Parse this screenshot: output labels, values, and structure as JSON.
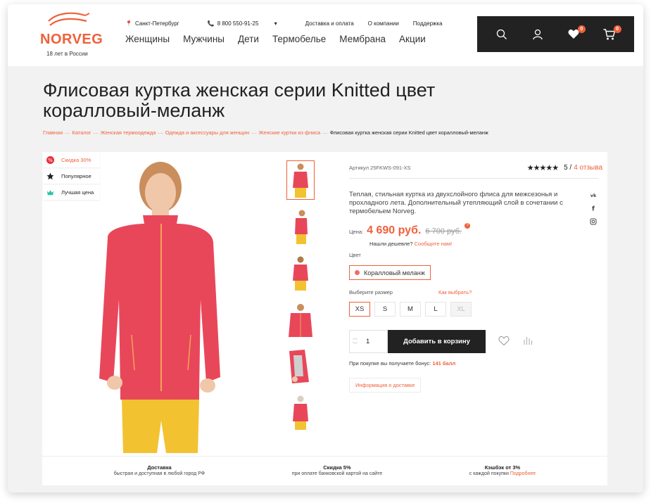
{
  "header": {
    "logo_text": "NORVEG",
    "logo_sub": "18 лет в России",
    "city": "Санкт-Петербург",
    "phone": "8 800 550-91-25",
    "phone_caret": "▾",
    "top_links": [
      "Доставка и оплата",
      "О компании",
      "Поддержка"
    ],
    "menu": [
      "Женщины",
      "Мужчины",
      "Дети",
      "Термобелье",
      "Мембрана",
      "Акции"
    ],
    "favorites_count": "0",
    "cart_count": "0",
    "icons": [
      "search-icon",
      "user-icon",
      "heart-icon",
      "cart-icon"
    ]
  },
  "product": {
    "title": "Флисовая куртка женская серии Knitted цвет коралловый-меланж",
    "breadcrumbs": [
      "Главная",
      "Каталог",
      "Женская термоодежда",
      "Одежда и аксессуары для женщин",
      "Женские куртки из флиса"
    ],
    "breadcrumb_current": "Флисовая куртка женская серии Knitted цвет коралловый-меланж",
    "breadcrumb_sep": "—",
    "labels": [
      "Скидка 30%",
      "Популярное",
      "Лучшая цена"
    ],
    "sku": "Артикул 25FKWS-091-XS",
    "rating_stars": "★★★★★",
    "rating": "5",
    "rating_sep": "/",
    "reviews": "4 отзыва",
    "description": "Теплая, стильная куртка из двухслойного флиса для межсезонья и прохладного лета. Дополнительный утепляющий слой в сочетании с термобельем Norveg.",
    "social": [
      "vk",
      "f",
      "ig"
    ],
    "price_label": "Цена:",
    "price": "4 690 руб.",
    "old_price": "6 700 руб.",
    "cheaper_text": "Нашли дешевле?",
    "cheaper_link": "Сообщите нам!",
    "color_label": "Цвет",
    "color": "Коралловый меланж",
    "size_label": "Выберите размер",
    "size_help": "Как выбрать?",
    "sizes": [
      "XS",
      "S",
      "M",
      "L",
      "XL"
    ],
    "quantity": "1",
    "add_to_cart": "Добавить в корзину",
    "bonus_text": "При покупке вы получаете бонус:",
    "bonus_value": "141 балл",
    "delivery_info": "Информация о доставке"
  },
  "features": [
    {
      "title": "Доставка",
      "text": "быстрая и доступная в любой город РФ",
      "link": ""
    },
    {
      "title": "Скидка 5%",
      "text": "при оплате банковской картой на сайте",
      "link": ""
    },
    {
      "title": "Кэшбэк от 3%",
      "text": "с каждой покупки",
      "link": "Подробнее"
    }
  ],
  "colors": {
    "accent": "#f0603a",
    "dark": "#222222",
    "jacket": "#e8475a",
    "pants": "#f2c230"
  }
}
